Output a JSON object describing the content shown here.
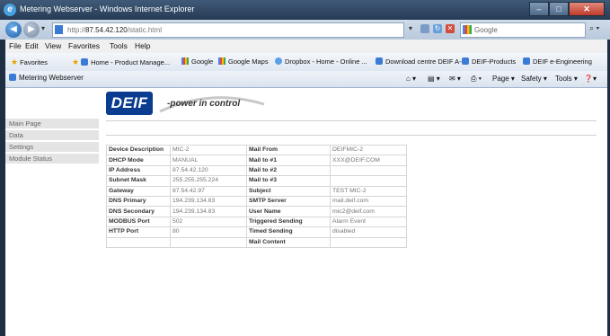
{
  "window": {
    "title": "Metering Webserver - Windows Internet Explorer",
    "min": "–",
    "max": "□",
    "close": "✕"
  },
  "address": {
    "prefix": "http://",
    "host": "87.54.42.120",
    "path": "/static.html",
    "search_placeholder": "Google",
    "back": "◀",
    "forward": "▶",
    "dropdown": "▾",
    "search_go": "⌕ ▾"
  },
  "menu": [
    "File",
    "Edit",
    "View",
    "Favorites",
    "Tools",
    "Help"
  ],
  "favorites": {
    "label": "Favorites",
    "items": [
      "Home - Product Manage...",
      "Google",
      "Google Maps",
      "Dropbox - Home - Online ...",
      "Download centre DEIF A-S",
      "DEIF-Products",
      "DEIF e-Engineering"
    ]
  },
  "tab": {
    "label": "Metering Webserver"
  },
  "commands": {
    "page": "Page ▾",
    "safety": "Safety ▾",
    "tools": "Tools ▾",
    "help": "❓▾"
  },
  "page": {
    "logo": "DEIF",
    "tagline": "-power in control",
    "sidebar": [
      "Main Page",
      "Data",
      "Settings",
      "Module Status"
    ],
    "table": [
      [
        "Device Description",
        "MIC-2",
        "Mail From",
        "DEIFMIC-2"
      ],
      [
        "DHCP Mode",
        "MANUAL",
        "Mail to #1",
        "XXX@DEIF.COM"
      ],
      [
        "IP Address",
        "87.54.42.120",
        "Mail to #2",
        ""
      ],
      [
        "Subnet Mask",
        "255.255.255.224",
        "Mail to #3",
        ""
      ],
      [
        "Gateway",
        "87.54.42.97",
        "Subject",
        "TEST MIC-2"
      ],
      [
        "DNS Primary",
        "194.239.134.83",
        "SMTP Server",
        "mail.deif.com"
      ],
      [
        "DNS Secondary",
        "194.239.134.83",
        "User Name",
        "mic2@deif.com"
      ],
      [
        "MODBUS Port",
        "502",
        "Triggered Sending",
        "Alarm Event"
      ],
      [
        "HTTP Port",
        "80",
        "Timed Sending",
        "disabled"
      ],
      [
        "",
        "",
        "Mail Content",
        ""
      ]
    ]
  }
}
